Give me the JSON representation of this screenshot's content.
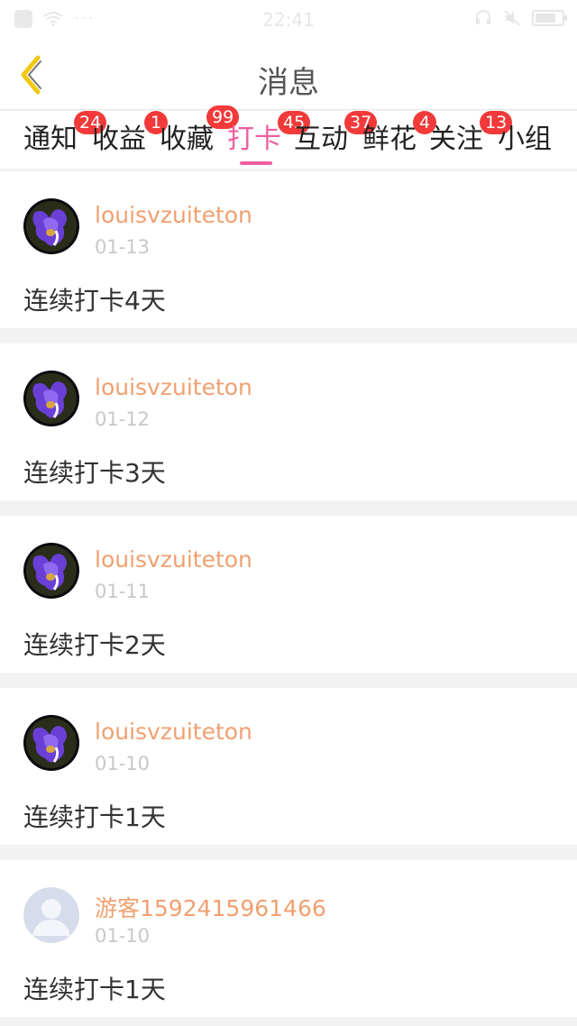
{
  "status_bar": {
    "time": "22:41",
    "dots": "···"
  },
  "header": {
    "title": "消息",
    "back_icon": "chevron-left-icon",
    "back_color": "#f2c811"
  },
  "tabs": [
    {
      "label": "通知",
      "badge": "24"
    },
    {
      "label": "收益",
      "badge": "1"
    },
    {
      "label": "收藏",
      "badge": "99"
    },
    {
      "label": "打卡",
      "badge": "45",
      "active": true
    },
    {
      "label": "互动",
      "badge": "37"
    },
    {
      "label": "鲜花",
      "badge": "4"
    },
    {
      "label": "关注",
      "badge": "13"
    },
    {
      "label": "小组",
      "badge": ""
    }
  ],
  "colors": {
    "accent": "#ee5fa0",
    "badge": "#f23a3a",
    "username": "#f0a070",
    "date": "#c8c8c8"
  },
  "messages": [
    {
      "user": "louisvzuiteton",
      "date": "01-13",
      "text": "连续打卡4天",
      "avatar": "flower-avatar"
    },
    {
      "user": "louisvzuiteton",
      "date": "01-12",
      "text": "连续打卡3天",
      "avatar": "flower-avatar"
    },
    {
      "user": "louisvzuiteton",
      "date": "01-11",
      "text": "连续打卡2天",
      "avatar": "flower-avatar"
    },
    {
      "user": "louisvzuiteton",
      "date": "01-10",
      "text": "连续打卡1天",
      "avatar": "flower-avatar"
    },
    {
      "user": "游客1592415961466",
      "date": "01-10",
      "text": "连续打卡1天",
      "avatar": "default-avatar"
    }
  ]
}
